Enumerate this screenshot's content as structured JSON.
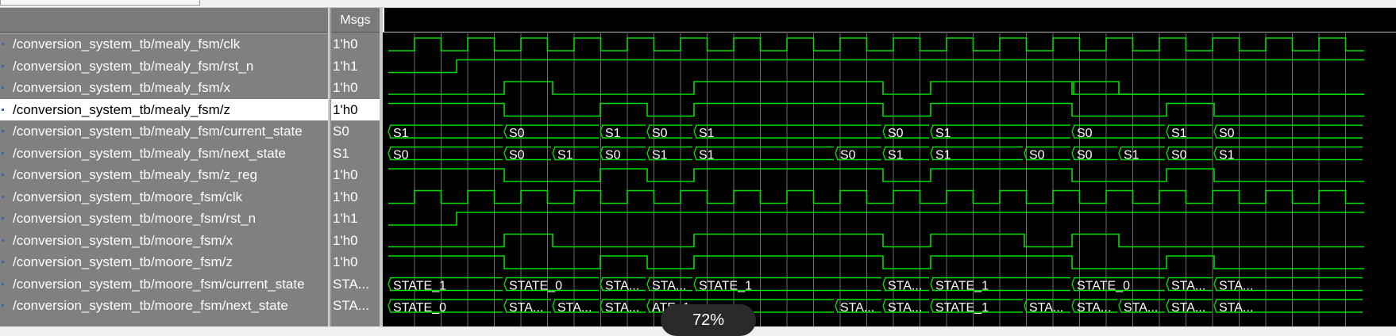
{
  "window": {
    "msgs_header": "Msgs",
    "zoom_badge": "72%"
  },
  "signals": [
    {
      "name": "/conversion_system_tb/mealy_fsm/clk",
      "value": "1'h0"
    },
    {
      "name": "/conversion_system_tb/mealy_fsm/rst_n",
      "value": "1'h1"
    },
    {
      "name": "/conversion_system_tb/mealy_fsm/x",
      "value": "1'h0"
    },
    {
      "name": "/conversion_system_tb/mealy_fsm/z",
      "value": "1'h0",
      "selected": true
    },
    {
      "name": "/conversion_system_tb/mealy_fsm/current_state",
      "value": "S0"
    },
    {
      "name": "/conversion_system_tb/mealy_fsm/next_state",
      "value": "S1"
    },
    {
      "name": "/conversion_system_tb/mealy_fsm/z_reg",
      "value": "1'h0"
    },
    {
      "name": "/conversion_system_tb/moore_fsm/clk",
      "value": "1'h0"
    },
    {
      "name": "/conversion_system_tb/moore_fsm/rst_n",
      "value": "1'h1"
    },
    {
      "name": "/conversion_system_tb/moore_fsm/x",
      "value": "1'h0"
    },
    {
      "name": "/conversion_system_tb/moore_fsm/z",
      "value": "1'h0"
    },
    {
      "name": "/conversion_system_tb/moore_fsm/current_state",
      "value": "STA..."
    },
    {
      "name": "/conversion_system_tb/moore_fsm/next_state",
      "value": "STA..."
    }
  ],
  "bus_labels": {
    "mealy_current": [
      "S1",
      "S0",
      "S1",
      "S0",
      "S1",
      "S0",
      "S1",
      "S0",
      "S1",
      "S0"
    ],
    "mealy_next": [
      "S0",
      "S0",
      "S1",
      "S0",
      "S1",
      "S1",
      "S0",
      "S1",
      "S1",
      "S0",
      "S0",
      "S1",
      "S0",
      "S1"
    ],
    "moore_current": [
      "STATE_1",
      "STATE_0",
      "STA...",
      "STA...",
      "STATE_1",
      "STA...",
      "STATE_1",
      "STATE_0",
      "STA...",
      "STA..."
    ],
    "moore_next": [
      "STATE_0",
      "STA...",
      "STA...",
      "STA...",
      "ATE_1",
      "STA...",
      "STA...",
      "STATE_1",
      "STA...",
      "STA...",
      "STA...",
      "STA...",
      "STA..."
    ]
  },
  "colors": {
    "wave": "#00dd00",
    "grid": "#6e6e6e",
    "background": "#000000",
    "panel": "#808080"
  }
}
